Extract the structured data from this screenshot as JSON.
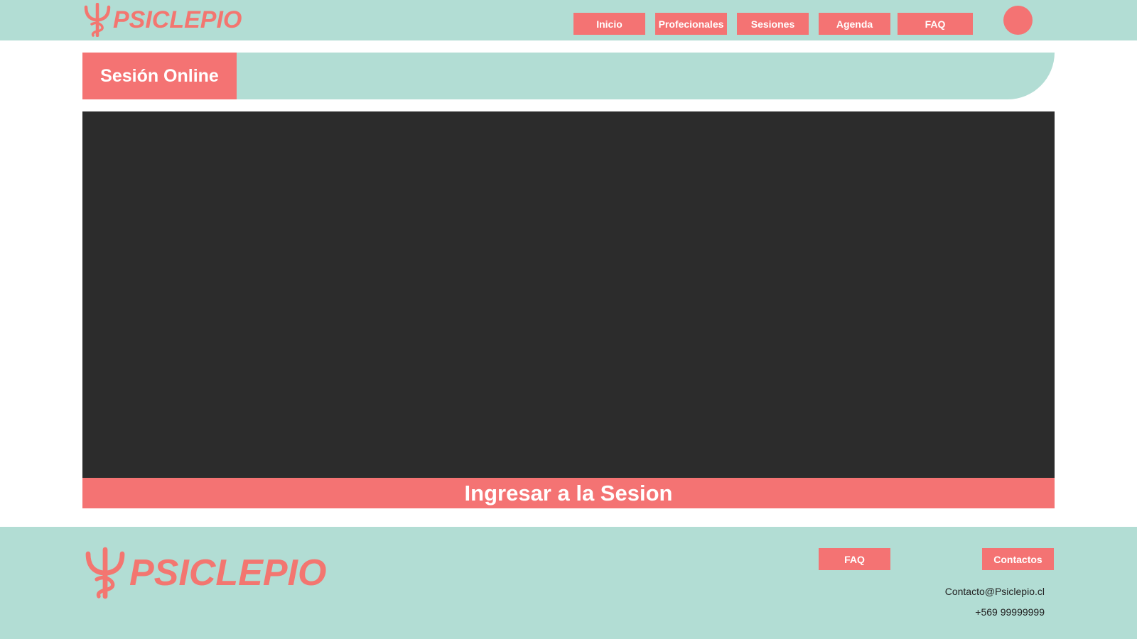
{
  "header": {
    "logo_text": "PSICLEPIO",
    "nav": [
      {
        "label": "Inicio"
      },
      {
        "label": "Profecionales"
      },
      {
        "label": "Sesiones"
      },
      {
        "label": "Agenda"
      },
      {
        "label": "FAQ"
      }
    ]
  },
  "section": {
    "title": "Sesión Online"
  },
  "session": {
    "join_label": "Ingresar a la Sesion"
  },
  "footer": {
    "logo_text": "PSICLEPIO",
    "links": [
      {
        "label": "FAQ"
      },
      {
        "label": "Contactos"
      }
    ],
    "email": "Contacto@Psiclepio.cl",
    "phone": "+569 99999999"
  },
  "colors": {
    "accent": "#f47373",
    "mint": "#b2ddd4",
    "video_bg": "#2c2c2c"
  },
  "icons": {
    "logo_symbol": "rod-of-asclepius-psi-icon",
    "avatar": "user-avatar-icon"
  }
}
